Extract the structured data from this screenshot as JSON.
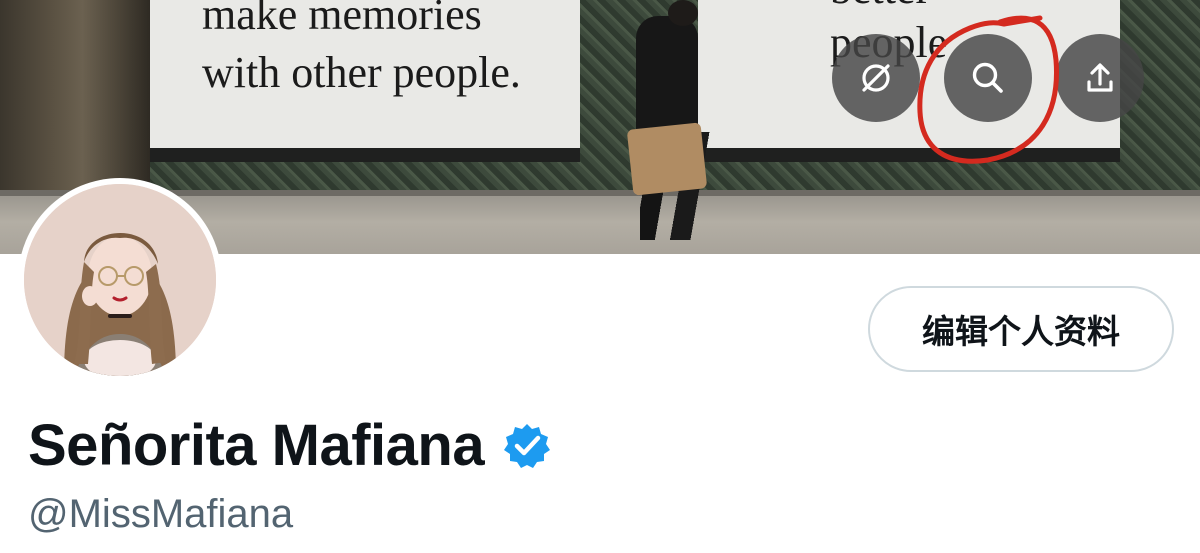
{
  "banner": {
    "poster_left_text_line1": "make memories",
    "poster_left_text_line2": "with other people.",
    "poster_right_text_line1": "better",
    "poster_right_text_line2": "people",
    "buttons": [
      {
        "icon": "disconnected-link-icon"
      },
      {
        "icon": "search-icon"
      },
      {
        "icon": "share-icon"
      }
    ],
    "annotation_color": "#d42a1f"
  },
  "profile": {
    "edit_profile_label": "编辑个人资料",
    "display_name": "Señorita Mafiana",
    "username": "@MissMafiana",
    "verified_color": "#1d9bf0"
  }
}
